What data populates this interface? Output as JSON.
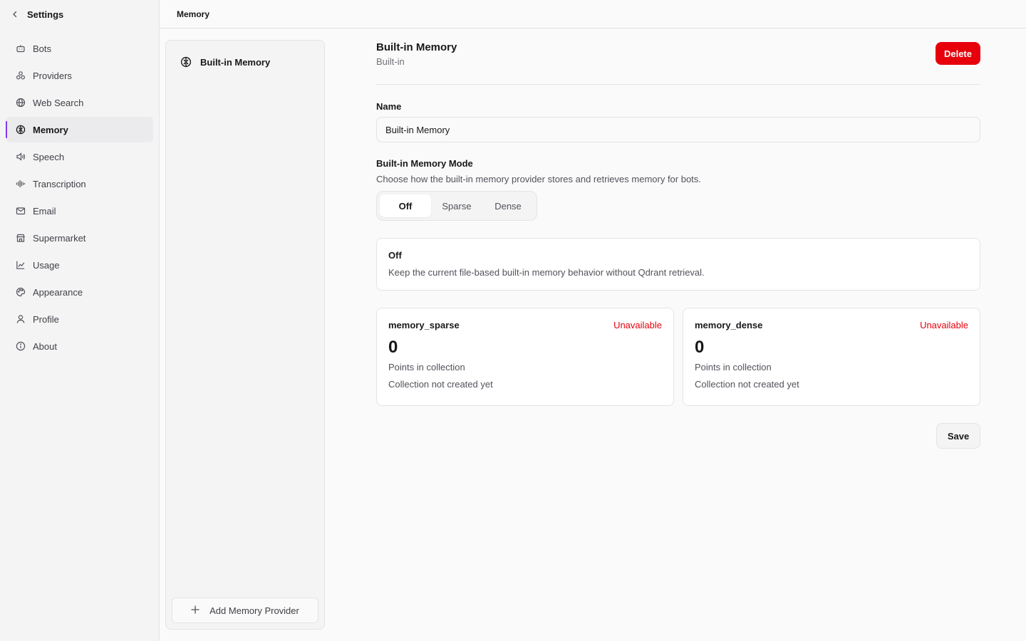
{
  "sidebar": {
    "title": "Settings",
    "items": [
      {
        "label": "Bots",
        "icon": "bot-icon"
      },
      {
        "label": "Providers",
        "icon": "providers-icon"
      },
      {
        "label": "Web Search",
        "icon": "globe-icon"
      },
      {
        "label": "Memory",
        "icon": "brain-icon",
        "active": true
      },
      {
        "label": "Speech",
        "icon": "speaker-icon"
      },
      {
        "label": "Transcription",
        "icon": "waveform-icon"
      },
      {
        "label": "Email",
        "icon": "mail-icon"
      },
      {
        "label": "Supermarket",
        "icon": "store-icon"
      },
      {
        "label": "Usage",
        "icon": "chart-icon"
      },
      {
        "label": "Appearance",
        "icon": "palette-icon"
      },
      {
        "label": "Profile",
        "icon": "user-icon"
      },
      {
        "label": "About",
        "icon": "info-icon"
      }
    ]
  },
  "topbar": {
    "breadcrumb": "Memory"
  },
  "provider_list": {
    "items": [
      {
        "label": "Built-in Memory",
        "icon": "brain-icon"
      }
    ],
    "add_label": "Add Memory Provider"
  },
  "main": {
    "title": "Built-in Memory",
    "subtitle": "Built-in",
    "delete_label": "Delete",
    "name_label": "Name",
    "name_value": "Built-in Memory",
    "mode_label": "Built-in Memory Mode",
    "mode_description": "Choose how the built-in memory provider stores and retrieves memory for bots.",
    "modes": [
      "Off",
      "Sparse",
      "Dense"
    ],
    "selected_mode": "Off",
    "info_title": "Off",
    "info_description": "Keep the current file-based built-in memory behavior without Qdrant retrieval.",
    "stats": [
      {
        "name": "memory_sparse",
        "status": "Unavailable",
        "count": "0",
        "caption": "Points in collection",
        "note": "Collection not created yet"
      },
      {
        "name": "memory_dense",
        "status": "Unavailable",
        "count": "0",
        "caption": "Points in collection",
        "note": "Collection not created yet"
      }
    ],
    "save_label": "Save"
  },
  "colors": {
    "accent": "#7c3aed",
    "danger": "#e7000b"
  }
}
